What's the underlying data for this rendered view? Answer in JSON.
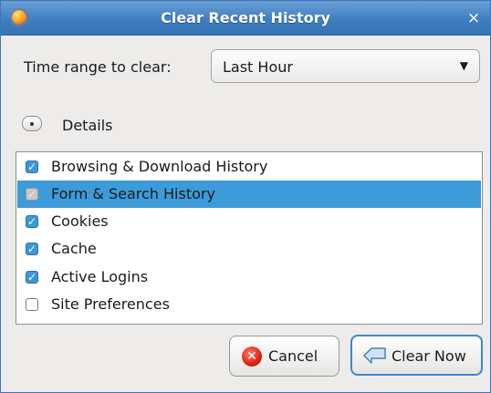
{
  "window": {
    "title": "Clear Recent History",
    "close_glyph": "×",
    "app_icon": "firefox-icon"
  },
  "time_range": {
    "label": "Time range to clear:",
    "selected": "Last Hour",
    "arrow_glyph": "▼"
  },
  "details": {
    "label": "Details"
  },
  "items": [
    {
      "label": "Browsing & Download History",
      "checked": true,
      "selected": false
    },
    {
      "label": "Form & Search History",
      "checked": true,
      "selected": true
    },
    {
      "label": "Cookies",
      "checked": true,
      "selected": false
    },
    {
      "label": "Cache",
      "checked": true,
      "selected": false
    },
    {
      "label": "Active Logins",
      "checked": true,
      "selected": false
    },
    {
      "label": "Site Preferences",
      "checked": false,
      "selected": false
    }
  ],
  "buttons": {
    "cancel": "Cancel",
    "clear_now": "Clear Now"
  },
  "colors": {
    "title_bar": "#3f7fc1",
    "selection": "#3d9bd9",
    "checkbox_on": "#3d97d7"
  }
}
